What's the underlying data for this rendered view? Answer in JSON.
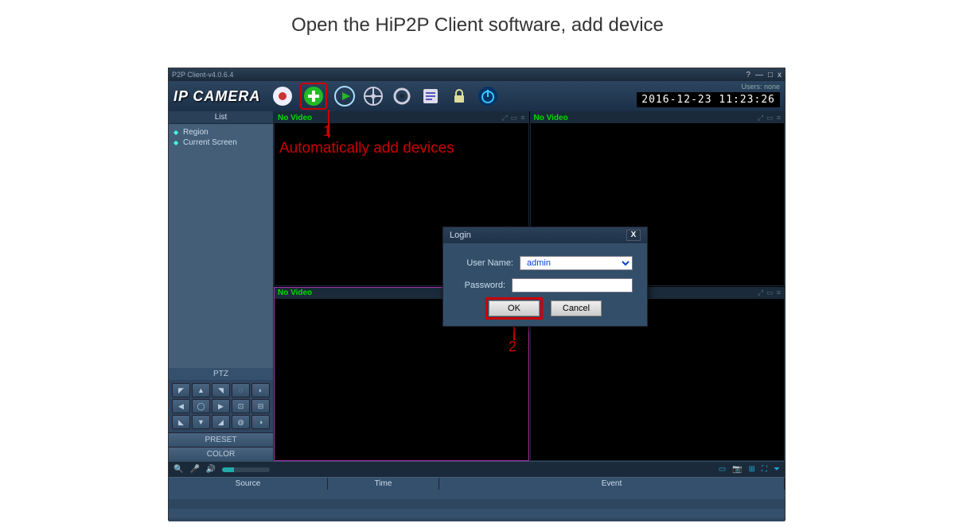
{
  "caption": "Open the HiP2P Client software, add device",
  "titlebar": {
    "title": "P2P Client-v4.0.6.4",
    "help": "?",
    "minimize": "—",
    "maximize": "□",
    "close": "x"
  },
  "header": {
    "logo": "IP CAMERA",
    "users_label": "Users: none",
    "datetime": "2016-12-23 11:23:26"
  },
  "sidebar": {
    "list_label": "List",
    "items": [
      "Region",
      "Current Screen"
    ],
    "ptz_label": "PTZ",
    "preset_label": "PRESET",
    "color_label": "COLOR"
  },
  "video": {
    "no_video_label": "No Video"
  },
  "callouts": {
    "step1_num": "1",
    "step1_text": "Automatically add devices",
    "step2_num": "2"
  },
  "dialog": {
    "title": "Login",
    "username_label": "User Name:",
    "username_value": "admin",
    "password_label": "Password:",
    "ok_label": "OK",
    "cancel_label": "Cancel"
  },
  "event_table": {
    "col_source": "Source",
    "col_time": "Time",
    "col_event": "Event"
  }
}
